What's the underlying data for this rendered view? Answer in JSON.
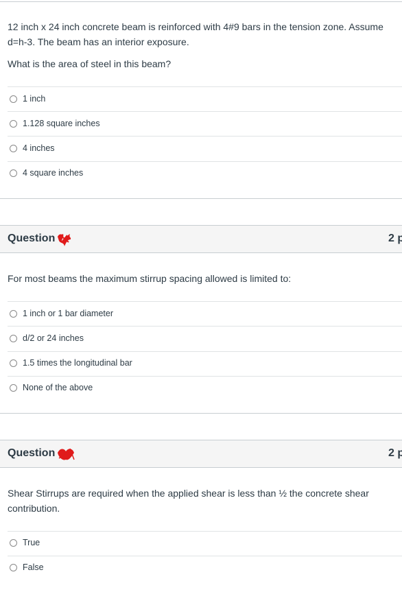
{
  "q1": {
    "text_line1": "12 inch x 24 inch concrete beam is reinforced with 4#9 bars in the tension zone. Assume",
    "text_line2": "d=h-3. The beam has an interior exposure.",
    "prompt": "What is the area of steel in this beam?",
    "options": [
      "1 inch",
      "1.128 square inches",
      "4 inches",
      "4 square inches"
    ]
  },
  "q2": {
    "title": "Question",
    "points": "2 p",
    "text": "For most beams the maximum stirrup spacing allowed is limited to:",
    "options": [
      "1 inch or 1 bar diameter",
      "d/2 or 24 inches",
      "1.5 times the longitudinal bar",
      "None of the above"
    ]
  },
  "q3": {
    "title": "Question",
    "points": "2 p",
    "text_line1": "Shear Stirrups are required when the applied shear is less than ½ the concrete shear",
    "text_line2": "contribution.",
    "options": [
      "True",
      "False"
    ]
  },
  "colors": {
    "text": "#2d3b45",
    "header_bg": "#f5f5f5",
    "border": "#c7cdd1",
    "scribble": "#e01b1b"
  }
}
